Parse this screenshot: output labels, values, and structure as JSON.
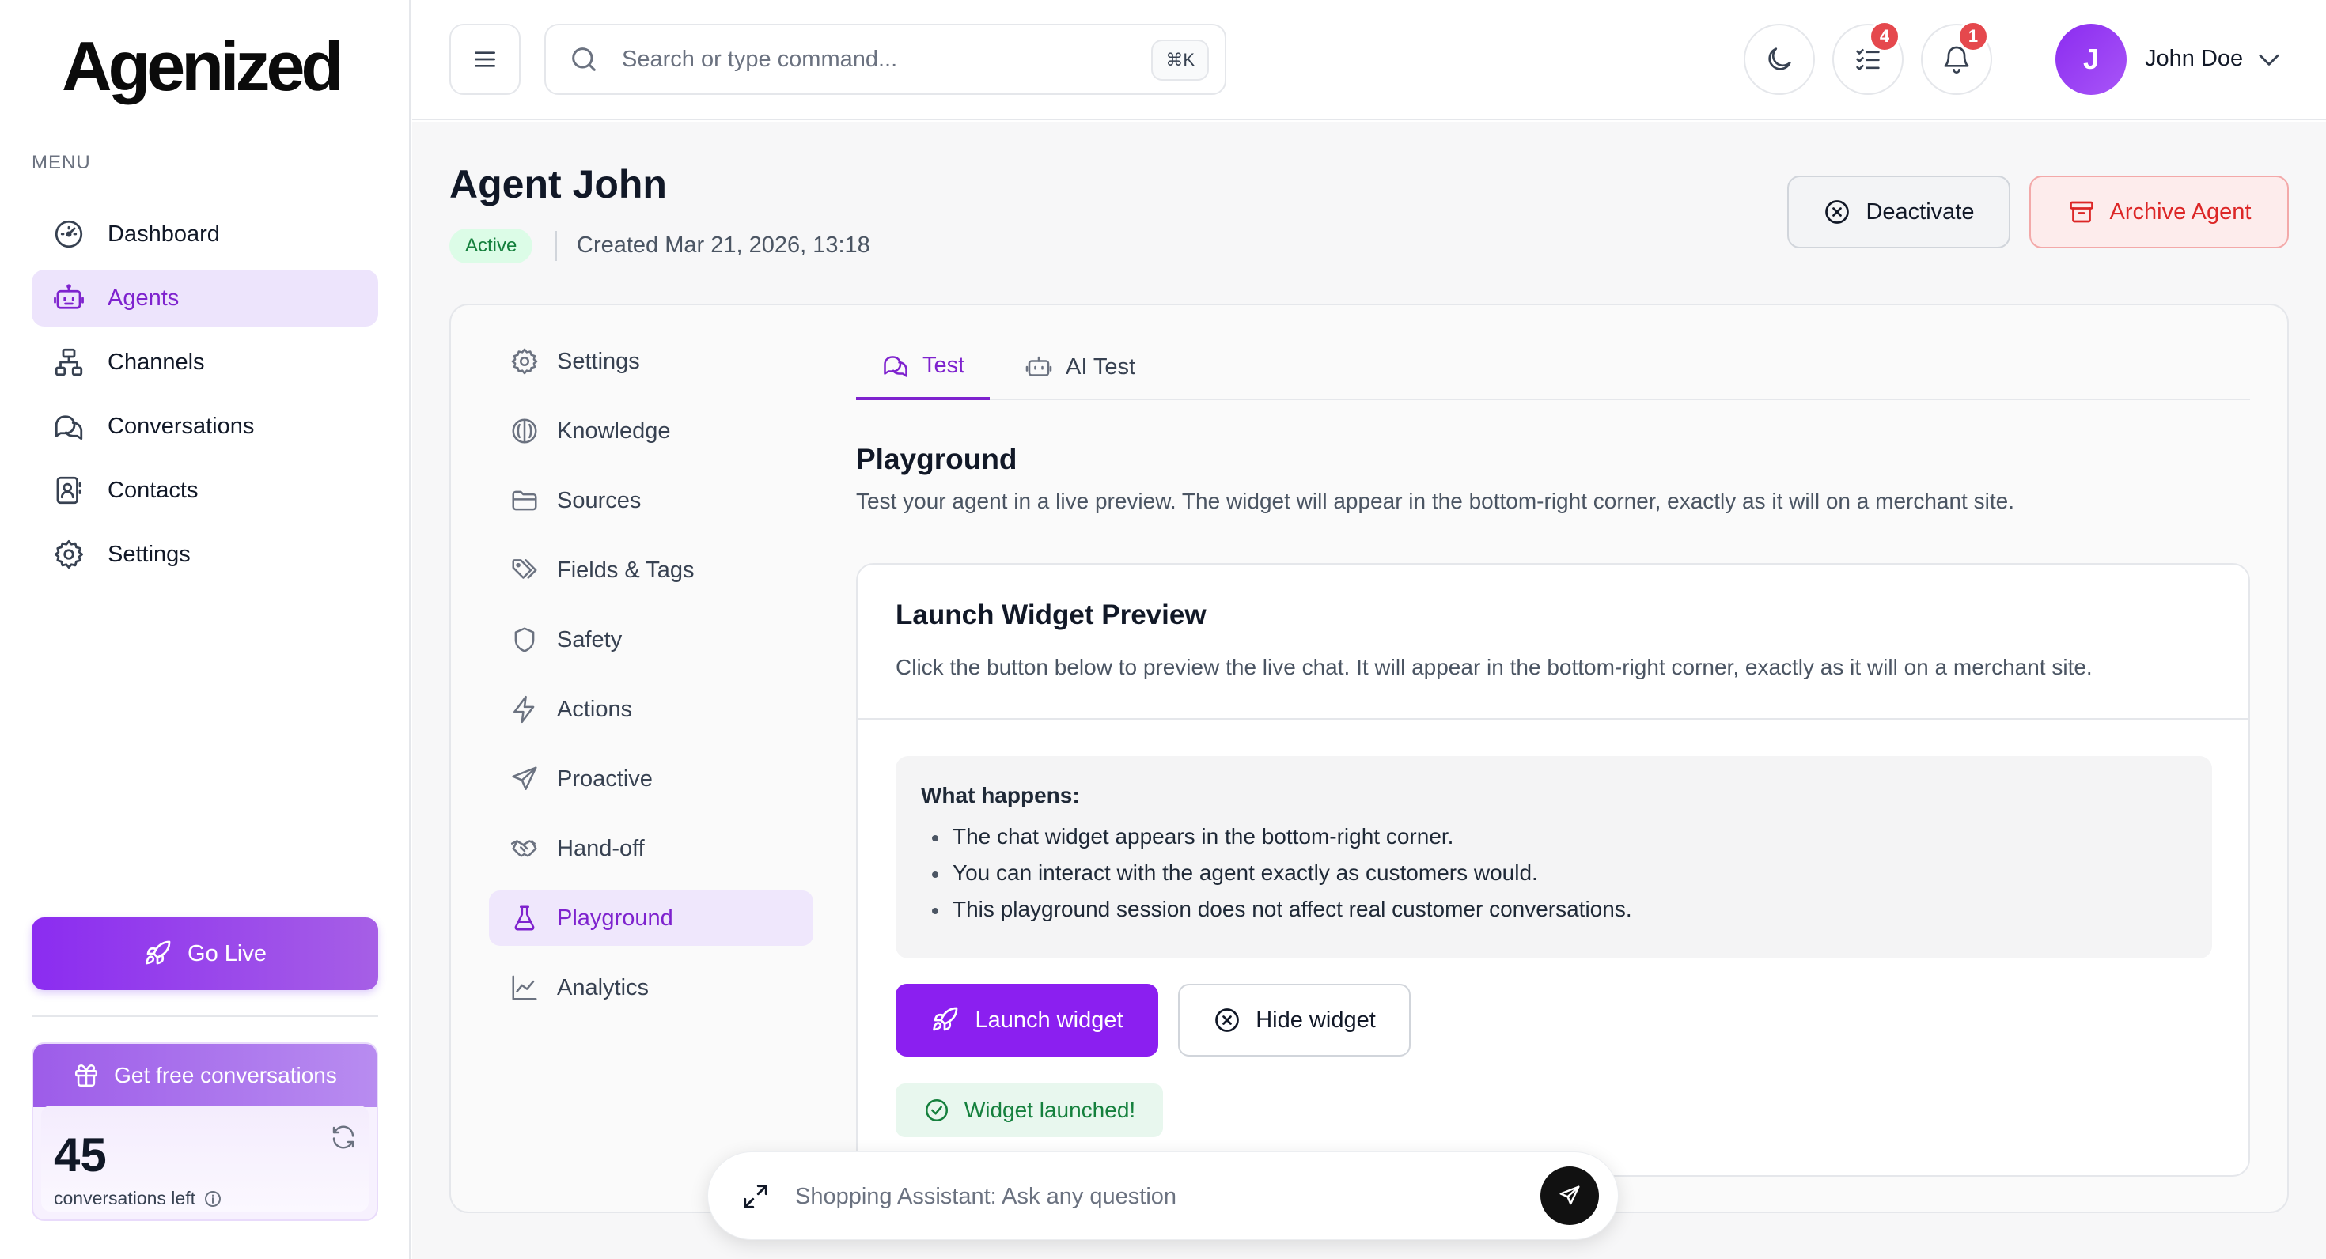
{
  "app": {
    "logo_text": "Agenized",
    "menu_label": "MENU"
  },
  "sidebar": {
    "items": [
      {
        "label": "Dashboard",
        "icon": "dashboard-icon"
      },
      {
        "label": "Agents",
        "icon": "bot-icon",
        "active": true
      },
      {
        "label": "Channels",
        "icon": "channels-icon"
      },
      {
        "label": "Conversations",
        "icon": "chat-icon"
      },
      {
        "label": "Contacts",
        "icon": "contacts-icon"
      },
      {
        "label": "Settings",
        "icon": "gear-icon"
      }
    ],
    "go_live_label": "Go Live",
    "promo": {
      "header": "Get free conversations",
      "count": "45",
      "subtitle": "conversations left"
    }
  },
  "topbar": {
    "search_placeholder": "Search or type command...",
    "shortcut": "⌘K",
    "tasks_badge": "4",
    "notifications_badge": "1",
    "avatar_initial": "J",
    "user_name": "John Doe"
  },
  "agent": {
    "name": "Agent John",
    "status": "Active",
    "created": "Created Mar 21, 2026, 13:18",
    "deactivate_label": "Deactivate",
    "archive_label": "Archive Agent"
  },
  "subnav": {
    "items": [
      {
        "label": "Settings",
        "icon": "gear-icon"
      },
      {
        "label": "Knowledge",
        "icon": "brain-icon"
      },
      {
        "label": "Sources",
        "icon": "folder-icon"
      },
      {
        "label": "Fields & Tags",
        "icon": "tags-icon"
      },
      {
        "label": "Safety",
        "icon": "shield-icon"
      },
      {
        "label": "Actions",
        "icon": "bolt-icon"
      },
      {
        "label": "Proactive",
        "icon": "send-icon"
      },
      {
        "label": "Hand-off",
        "icon": "handshake-icon"
      },
      {
        "label": "Playground",
        "icon": "flask-icon",
        "active": true
      },
      {
        "label": "Analytics",
        "icon": "chart-icon"
      }
    ]
  },
  "tabs": [
    {
      "label": "Test",
      "active": true
    },
    {
      "label": "AI Test",
      "active": false
    }
  ],
  "playground": {
    "title": "Playground",
    "description": "Test your agent in a live preview. The widget will appear in the bottom-right corner, exactly as it will on a merchant site.",
    "card": {
      "title": "Launch Widget Preview",
      "description": "Click the button below to preview the live chat. It will appear in the bottom-right corner, exactly as it will on a merchant site.",
      "info_title": "What happens:",
      "info_items": [
        "The chat widget appears in the bottom-right corner.",
        "You can interact with the agent exactly as customers would.",
        "This playground session does not affect real customer conversations."
      ],
      "launch_label": "Launch widget",
      "hide_label": "Hide widget",
      "success_text": "Widget launched!"
    }
  },
  "chat_widget": {
    "placeholder": "Shopping Assistant: Ask any question"
  },
  "colors": {
    "accent": "#8b1ff0",
    "accent_text": "#7e22ce",
    "danger": "#dc2626",
    "success": "#15803d",
    "badge": "#e5484d"
  }
}
